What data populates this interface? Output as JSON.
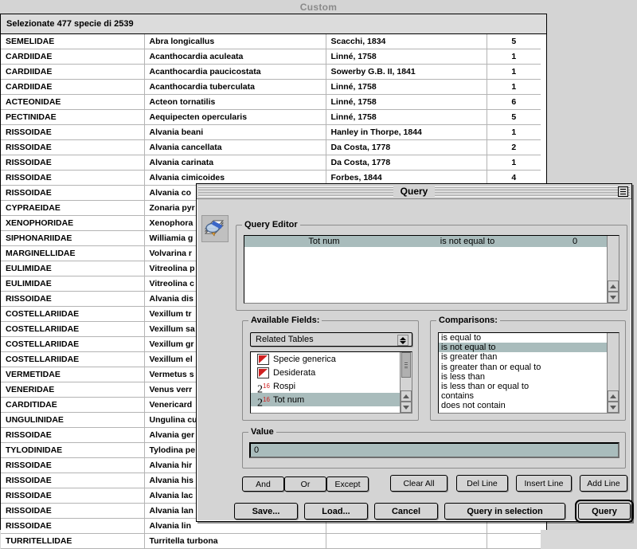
{
  "custom_window": {
    "title": "Custom",
    "status": "Selezionate 477 specie di 2539",
    "table": {
      "rows": [
        {
          "family": "SEMELIDAE",
          "species": "Abra longicallus",
          "author": "Scacchi, 1834",
          "num": "5"
        },
        {
          "family": "CARDIIDAE",
          "species": "Acanthocardia aculeata",
          "author": "Linné, 1758",
          "num": "1"
        },
        {
          "family": "CARDIIDAE",
          "species": "Acanthocardia paucicostata",
          "author": "Sowerby G.B. II, 1841",
          "num": "1"
        },
        {
          "family": "CARDIIDAE",
          "species": "Acanthocardia tuberculata",
          "author": "Linné, 1758",
          "num": "1"
        },
        {
          "family": "ACTEONIDAE",
          "species": "Acteon tornatilis",
          "author": "Linné, 1758",
          "num": "6"
        },
        {
          "family": "PECTINIDAE",
          "species": "Aequipecten opercularis",
          "author": "Linné, 1758",
          "num": "5"
        },
        {
          "family": "RISSOIDAE",
          "species": "Alvania beani",
          "author": "Hanley in Thorpe, 1844",
          "num": "1"
        },
        {
          "family": "RISSOIDAE",
          "species": "Alvania cancellata",
          "author": "Da Costa, 1778",
          "num": "2"
        },
        {
          "family": "RISSOIDAE",
          "species": "Alvania carinata",
          "author": "Da Costa, 1778",
          "num": "1"
        },
        {
          "family": "RISSOIDAE",
          "species": "Alvania cimicoides",
          "author": "Forbes, 1844",
          "num": "4"
        },
        {
          "family": "RISSOIDAE",
          "species": "Alvania co",
          "author": "",
          "num": ""
        },
        {
          "family": "CYPRAEIDAE",
          "species": "Zonaria pyr",
          "author": "",
          "num": ""
        },
        {
          "family": "XENOPHORIDAE",
          "species": "Xenophora",
          "author": "",
          "num": ""
        },
        {
          "family": "SIPHONARIIDAE",
          "species": "Williamia g",
          "author": "",
          "num": ""
        },
        {
          "family": "MARGINELLIDAE",
          "species": "Volvarina r",
          "author": "",
          "num": ""
        },
        {
          "family": "EULIMIDAE",
          "species": "Vitreolina p",
          "author": "",
          "num": ""
        },
        {
          "family": "EULIMIDAE",
          "species": "Vitreolina c",
          "author": "",
          "num": ""
        },
        {
          "family": "RISSOIDAE",
          "species": "Alvania dis",
          "author": "",
          "num": ""
        },
        {
          "family": "COSTELLARIIDAE",
          "species": "Vexillum tr",
          "author": "",
          "num": ""
        },
        {
          "family": "COSTELLARIIDAE",
          "species": "Vexillum sa",
          "author": "",
          "num": ""
        },
        {
          "family": "COSTELLARIIDAE",
          "species": "Vexillum gr",
          "author": "",
          "num": ""
        },
        {
          "family": "COSTELLARIIDAE",
          "species": "Vexillum el",
          "author": "",
          "num": ""
        },
        {
          "family": "VERMETIDAE",
          "species": "Vermetus s",
          "author": "",
          "num": ""
        },
        {
          "family": "VENERIDAE",
          "species": "Venus verr",
          "author": "",
          "num": ""
        },
        {
          "family": "CARDITIDAE",
          "species": "Venericard",
          "author": "",
          "num": ""
        },
        {
          "family": "UNGULINIDAE",
          "species": "Ungulina cu",
          "author": "",
          "num": ""
        },
        {
          "family": "RISSOIDAE",
          "species": "Alvania ger",
          "author": "",
          "num": ""
        },
        {
          "family": "TYLODINIDAE",
          "species": "Tylodina pe",
          "author": "",
          "num": ""
        },
        {
          "family": "RISSOIDAE",
          "species": "Alvania hir",
          "author": "",
          "num": ""
        },
        {
          "family": "RISSOIDAE",
          "species": "Alvania his",
          "author": "",
          "num": ""
        },
        {
          "family": "RISSOIDAE",
          "species": "Alvania lac",
          "author": "",
          "num": ""
        },
        {
          "family": "RISSOIDAE",
          "species": "Alvania lan",
          "author": "",
          "num": ""
        },
        {
          "family": "RISSOIDAE",
          "species": "Alvania lin",
          "author": "",
          "num": ""
        },
        {
          "family": "TURRITELLIDAE",
          "species": "Turritella turbona",
          "author": "",
          "num": ""
        }
      ]
    }
  },
  "query_dialog": {
    "title": "Query",
    "icon_name": "query-document-magnifier-icon",
    "collapse_box_name": "windowshade-box",
    "query_editor": {
      "legend": "Query Editor",
      "lines": [
        {
          "field": "Tot num",
          "comparison": "is not equal to",
          "value": "0"
        }
      ]
    },
    "available_fields": {
      "legend": "Available Fields:",
      "popup_selected": "Related Tables",
      "items": [
        {
          "label": "Specie generica",
          "icon": "picture-field-icon",
          "selected": false
        },
        {
          "label": "Desiderata",
          "icon": "picture-field-icon",
          "selected": false
        },
        {
          "label": "Rospi",
          "icon": "number-field-icon",
          "selected": false
        },
        {
          "label": "Tot num",
          "icon": "number-field-icon",
          "selected": true
        }
      ]
    },
    "comparisons": {
      "legend": "Comparisons:",
      "items": [
        {
          "label": "is equal to",
          "selected": false
        },
        {
          "label": "is not equal to",
          "selected": true
        },
        {
          "label": "is greater than",
          "selected": false
        },
        {
          "label": "is greater than or equal to",
          "selected": false
        },
        {
          "label": "is less than",
          "selected": false
        },
        {
          "label": "is less than or equal to",
          "selected": false
        },
        {
          "label": "contains",
          "selected": false
        },
        {
          "label": "does not contain",
          "selected": false
        }
      ]
    },
    "value": {
      "legend": "Value",
      "text": "0"
    },
    "operator_buttons": {
      "and": "And",
      "or": "Or",
      "except": "Except"
    },
    "line_buttons": {
      "clear_all": "Clear All",
      "del_line": "Del Line",
      "insert_line": "Insert Line",
      "add_line": "Add Line"
    },
    "bottom_buttons": {
      "save": "Save...",
      "load": "Load...",
      "cancel": "Cancel",
      "query_in_selection": "Query in selection",
      "query": "Query"
    }
  },
  "colors": {
    "window_bg": "#d4d4d4",
    "highlight": "#a9bcbc",
    "title_inactive": "#8a8a8a",
    "field_icon_red": "#cf2020"
  }
}
